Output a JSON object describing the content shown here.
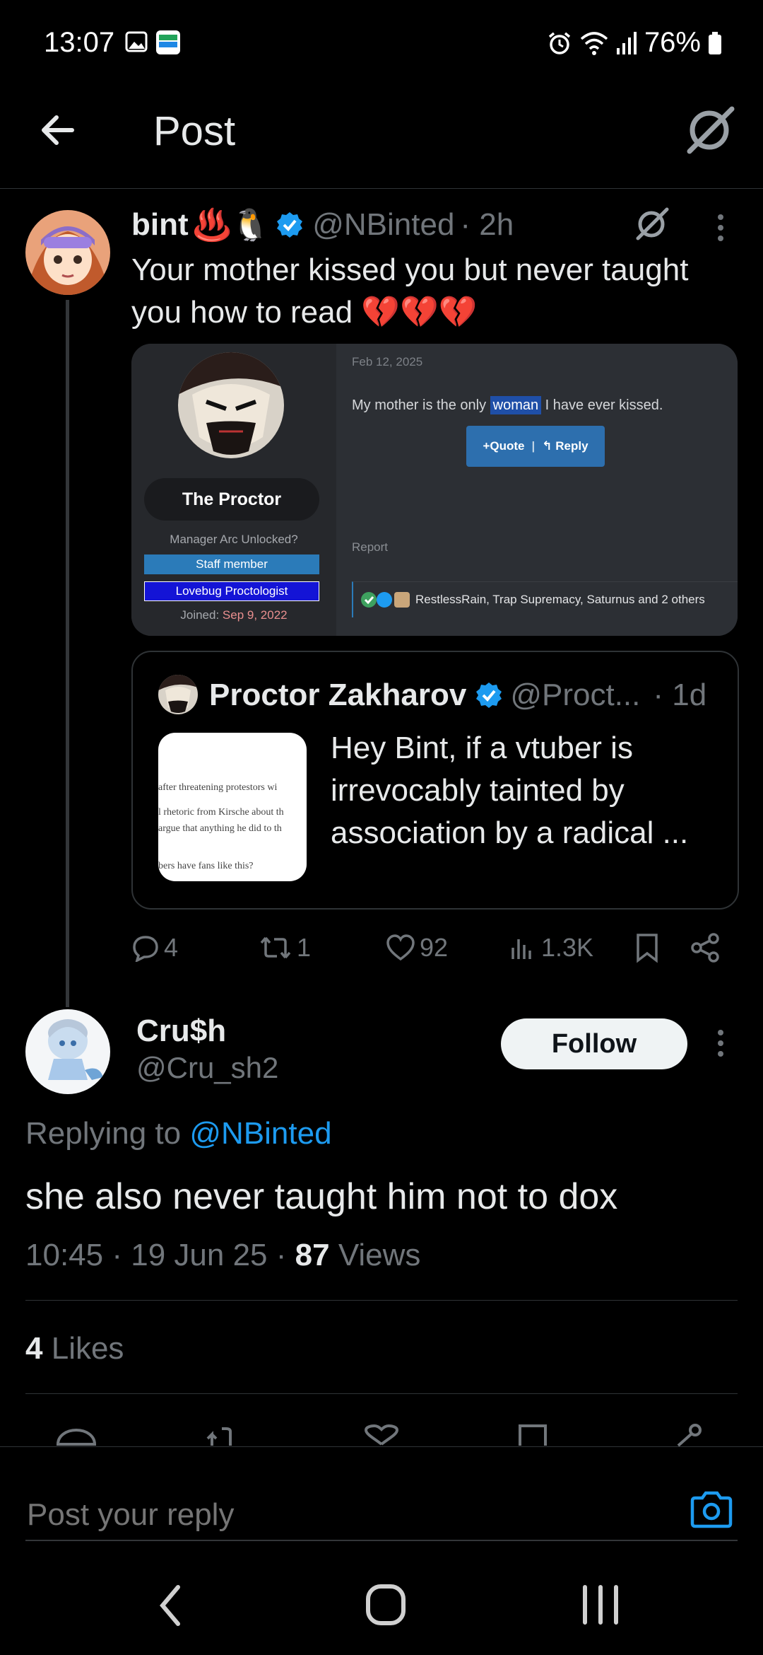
{
  "status_bar": {
    "time": "13:07",
    "battery": "76%",
    "icons": [
      "image-icon",
      "app-icon",
      "alarm-icon",
      "wifi-icon",
      "signal-icon",
      "battery-icon"
    ]
  },
  "header": {
    "back_icon": "arrow-left-icon",
    "title": "Post",
    "grok_icon": "grok-icon"
  },
  "parent_tweet": {
    "name": "bint",
    "emojis": "♨️🐧",
    "handle": "@NBinted",
    "time": "· 2h",
    "text": "Your mother kissed you but never taught you how to read 💔💔💔",
    "media": {
      "date": "Feb 12, 2025",
      "message_before": "My mother is the only ",
      "message_highlight": "woman",
      "message_after": " I have ever kissed.",
      "quote_btn": "+Quote",
      "reply_btn": "↰ Reply",
      "user_name": "The Proctor",
      "user_title": "Manager Arc Unlocked?",
      "staff_tag": "Staff member",
      "custom_tag": "Lovebug Proctologist",
      "joined_label": "Joined: ",
      "joined_date": "Sep 9, 2022",
      "report": "Report",
      "reactions": "RestlessRain, Trap Supremacy, Saturnus and 2 others"
    },
    "quote": {
      "name": "Proctor Zakharov",
      "handle": "@Proct...",
      "time": "· 1d",
      "text": "Hey Bint, if a vtuber is irrevocably tainted by association by a radical ...",
      "thumb_lines": [
        "after threatening protestors wi",
        "l rhetoric from Kirsche about th",
        "argue that anything he did to th",
        "bers have fans like this?"
      ]
    },
    "actions": {
      "replies": "4",
      "reposts": "1",
      "likes": "92",
      "views": "1.3K"
    }
  },
  "reply_tweet": {
    "name": "Cru$h",
    "handle": "@Cru_sh2",
    "follow_label": "Follow",
    "replying_to_label": "Replying to ",
    "replying_to_handle": "@NBinted",
    "text": "she also never taught him not to dox",
    "time": "10:45",
    "date": "19 Jun 25",
    "views_count": "87",
    "views_label": "Views",
    "likes_count": "4",
    "likes_label": "Likes"
  },
  "composer": {
    "placeholder": "Post your reply"
  },
  "colors": {
    "accent": "#1d9bf0",
    "background": "#000000",
    "text": "#e7e9ea",
    "muted": "#71767b"
  }
}
